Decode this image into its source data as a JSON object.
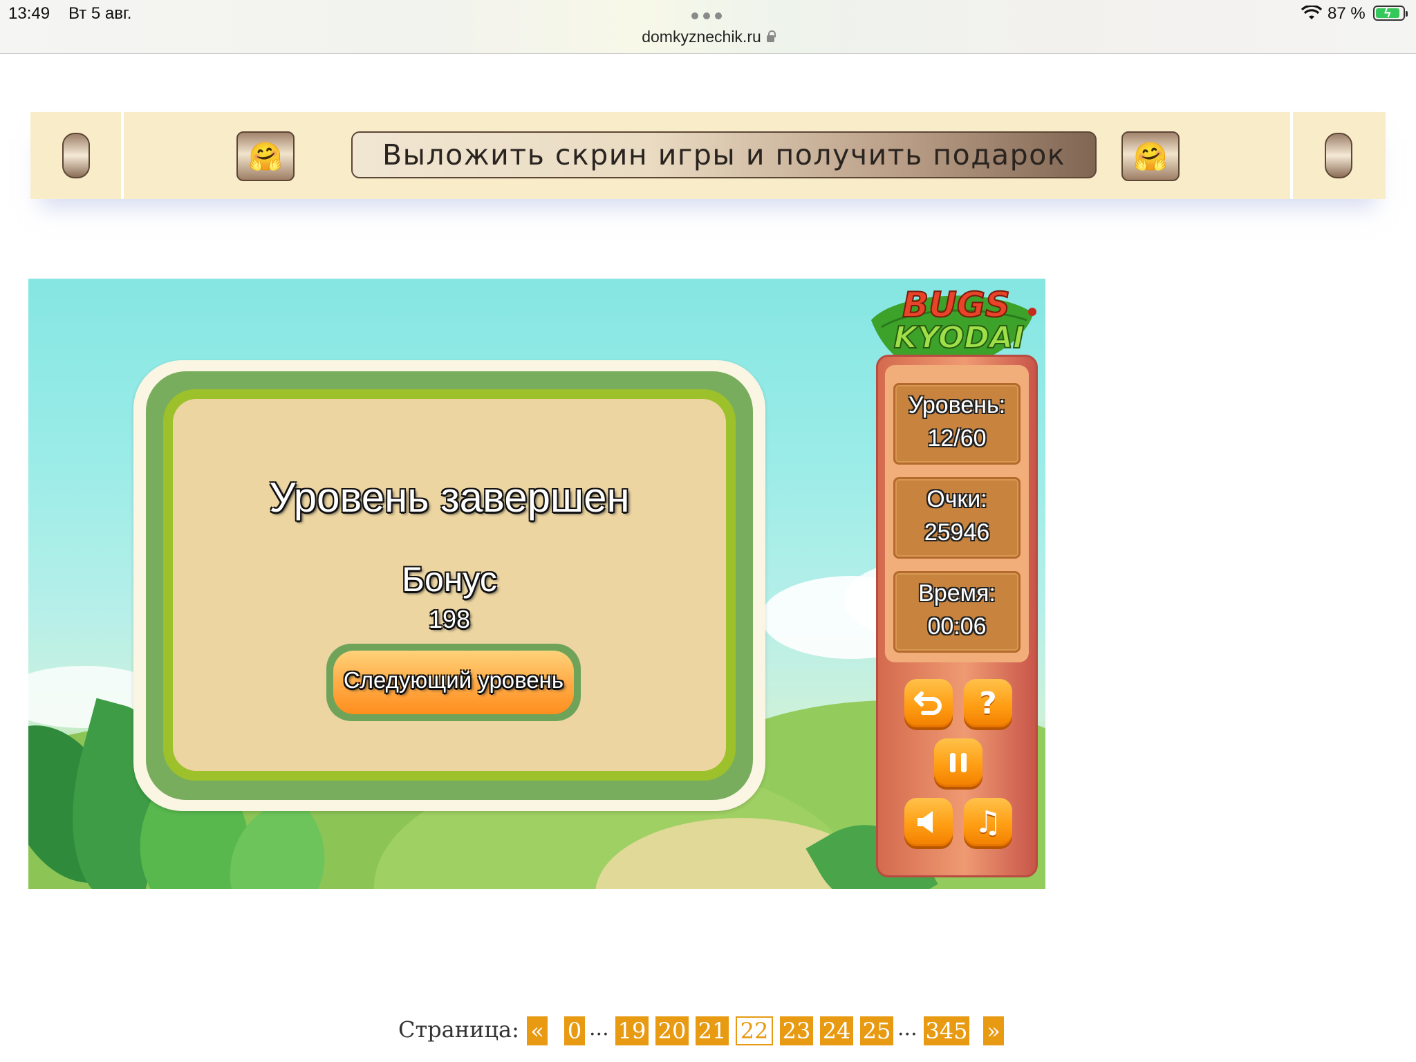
{
  "status_bar": {
    "time": "13:49",
    "date": "Вт 5 авг.",
    "url": "domkyznechik.ru",
    "battery": "87 %"
  },
  "banner": {
    "share_label": "Выложить скрин игры и получить подарок",
    "emoji": "🤗"
  },
  "game": {
    "logo_top": "BUGS",
    "logo_bottom": "KYODAI",
    "dialog": {
      "title": "Уровень завершен",
      "bonus_label": "Бонус",
      "bonus_value": "198",
      "next_button": "Следующий уровень"
    },
    "stats": {
      "level_label": "Уровень:",
      "level_value": "12/60",
      "score_label": "Очки:",
      "score_value": "25946",
      "time_label": "Время:",
      "time_value": "00:06"
    },
    "controls": {
      "undo_icon": "undo-icon",
      "help_icon": "help-icon",
      "pause_icon": "pause-icon",
      "sound_icon": "speaker-icon",
      "music_icon": "music-note-icon",
      "help_glyph": "?",
      "music_glyph": "♫"
    }
  },
  "pagination": {
    "label": "Страница:",
    "prev": "«",
    "next": "»",
    "ellipsis": "...",
    "pages": [
      "0",
      "19",
      "20",
      "21",
      "22",
      "23",
      "24",
      "25",
      "345"
    ],
    "current": "22"
  },
  "colors": {
    "banner_bg": "#f9ecc8",
    "page_button": "#e79a12",
    "dialog_inner": "#ecd5a1",
    "accent_orange": "#ff9e14"
  }
}
